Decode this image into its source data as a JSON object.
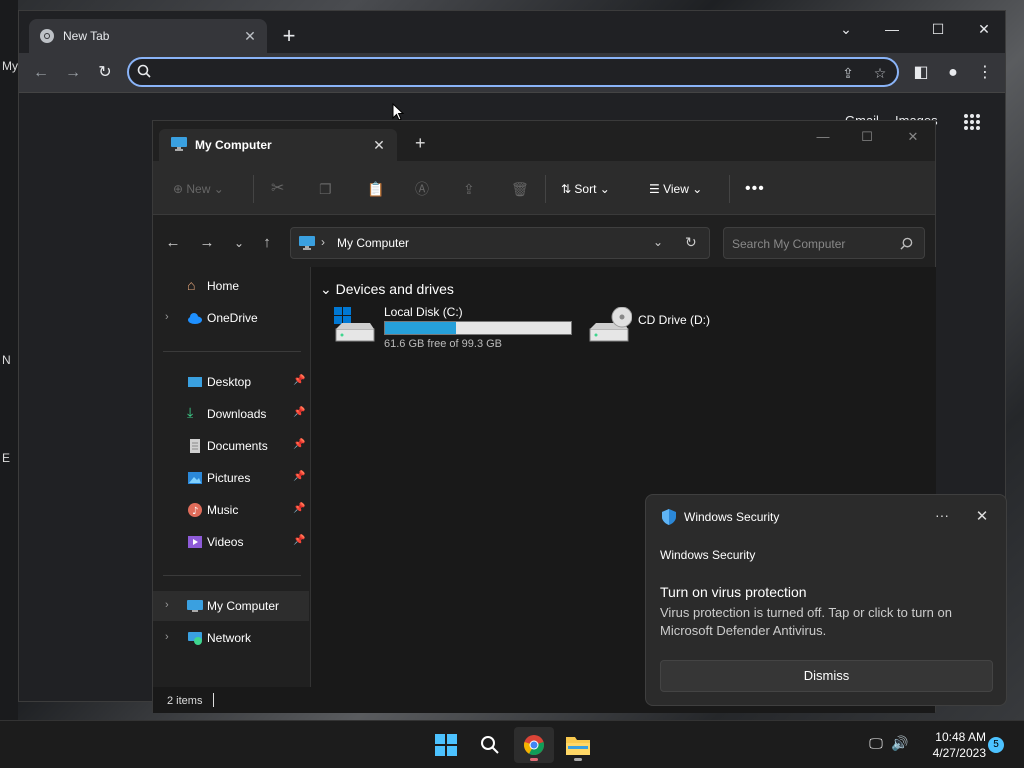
{
  "desktop": {
    "side_labels": [
      "My",
      "N",
      "E"
    ]
  },
  "chrome": {
    "tab_title": "New Tab",
    "omnibox": {
      "value": "",
      "placeholder": ""
    },
    "ntp_links": {
      "gmail": "Gmail",
      "images": "Images"
    }
  },
  "explorer": {
    "tab_title": "My Computer",
    "commands": {
      "new": "New",
      "sort": "Sort",
      "view": "View"
    },
    "address_path": "My Computer",
    "search_placeholder": "Search My Computer",
    "sidebar": {
      "home": "Home",
      "onedrive": "OneDrive",
      "pinned": [
        "Desktop",
        "Downloads",
        "Documents",
        "Pictures",
        "Music",
        "Videos"
      ],
      "my_computer": "My Computer",
      "network": "Network"
    },
    "group_header": "Devices and drives",
    "drives": [
      {
        "name": "Local Disk (C:)",
        "free_text": "61.6 GB free of 99.3 GB",
        "used_fraction": 0.38
      },
      {
        "name": "CD Drive (D:)"
      }
    ],
    "status": "2 items"
  },
  "notification": {
    "app_name": "Windows Security",
    "attribution": "Windows Security",
    "headline": "Turn on virus protection",
    "body": "Virus protection is turned off. Tap or click to turn on Microsoft Defender Antivirus.",
    "dismiss_label": "Dismiss"
  },
  "taskbar": {
    "time": "10:48 AM",
    "date": "4/27/2023",
    "notification_count": "5"
  },
  "colors": {
    "accent": "#26a0da",
    "chrome_focus": "#8ab4f8"
  }
}
